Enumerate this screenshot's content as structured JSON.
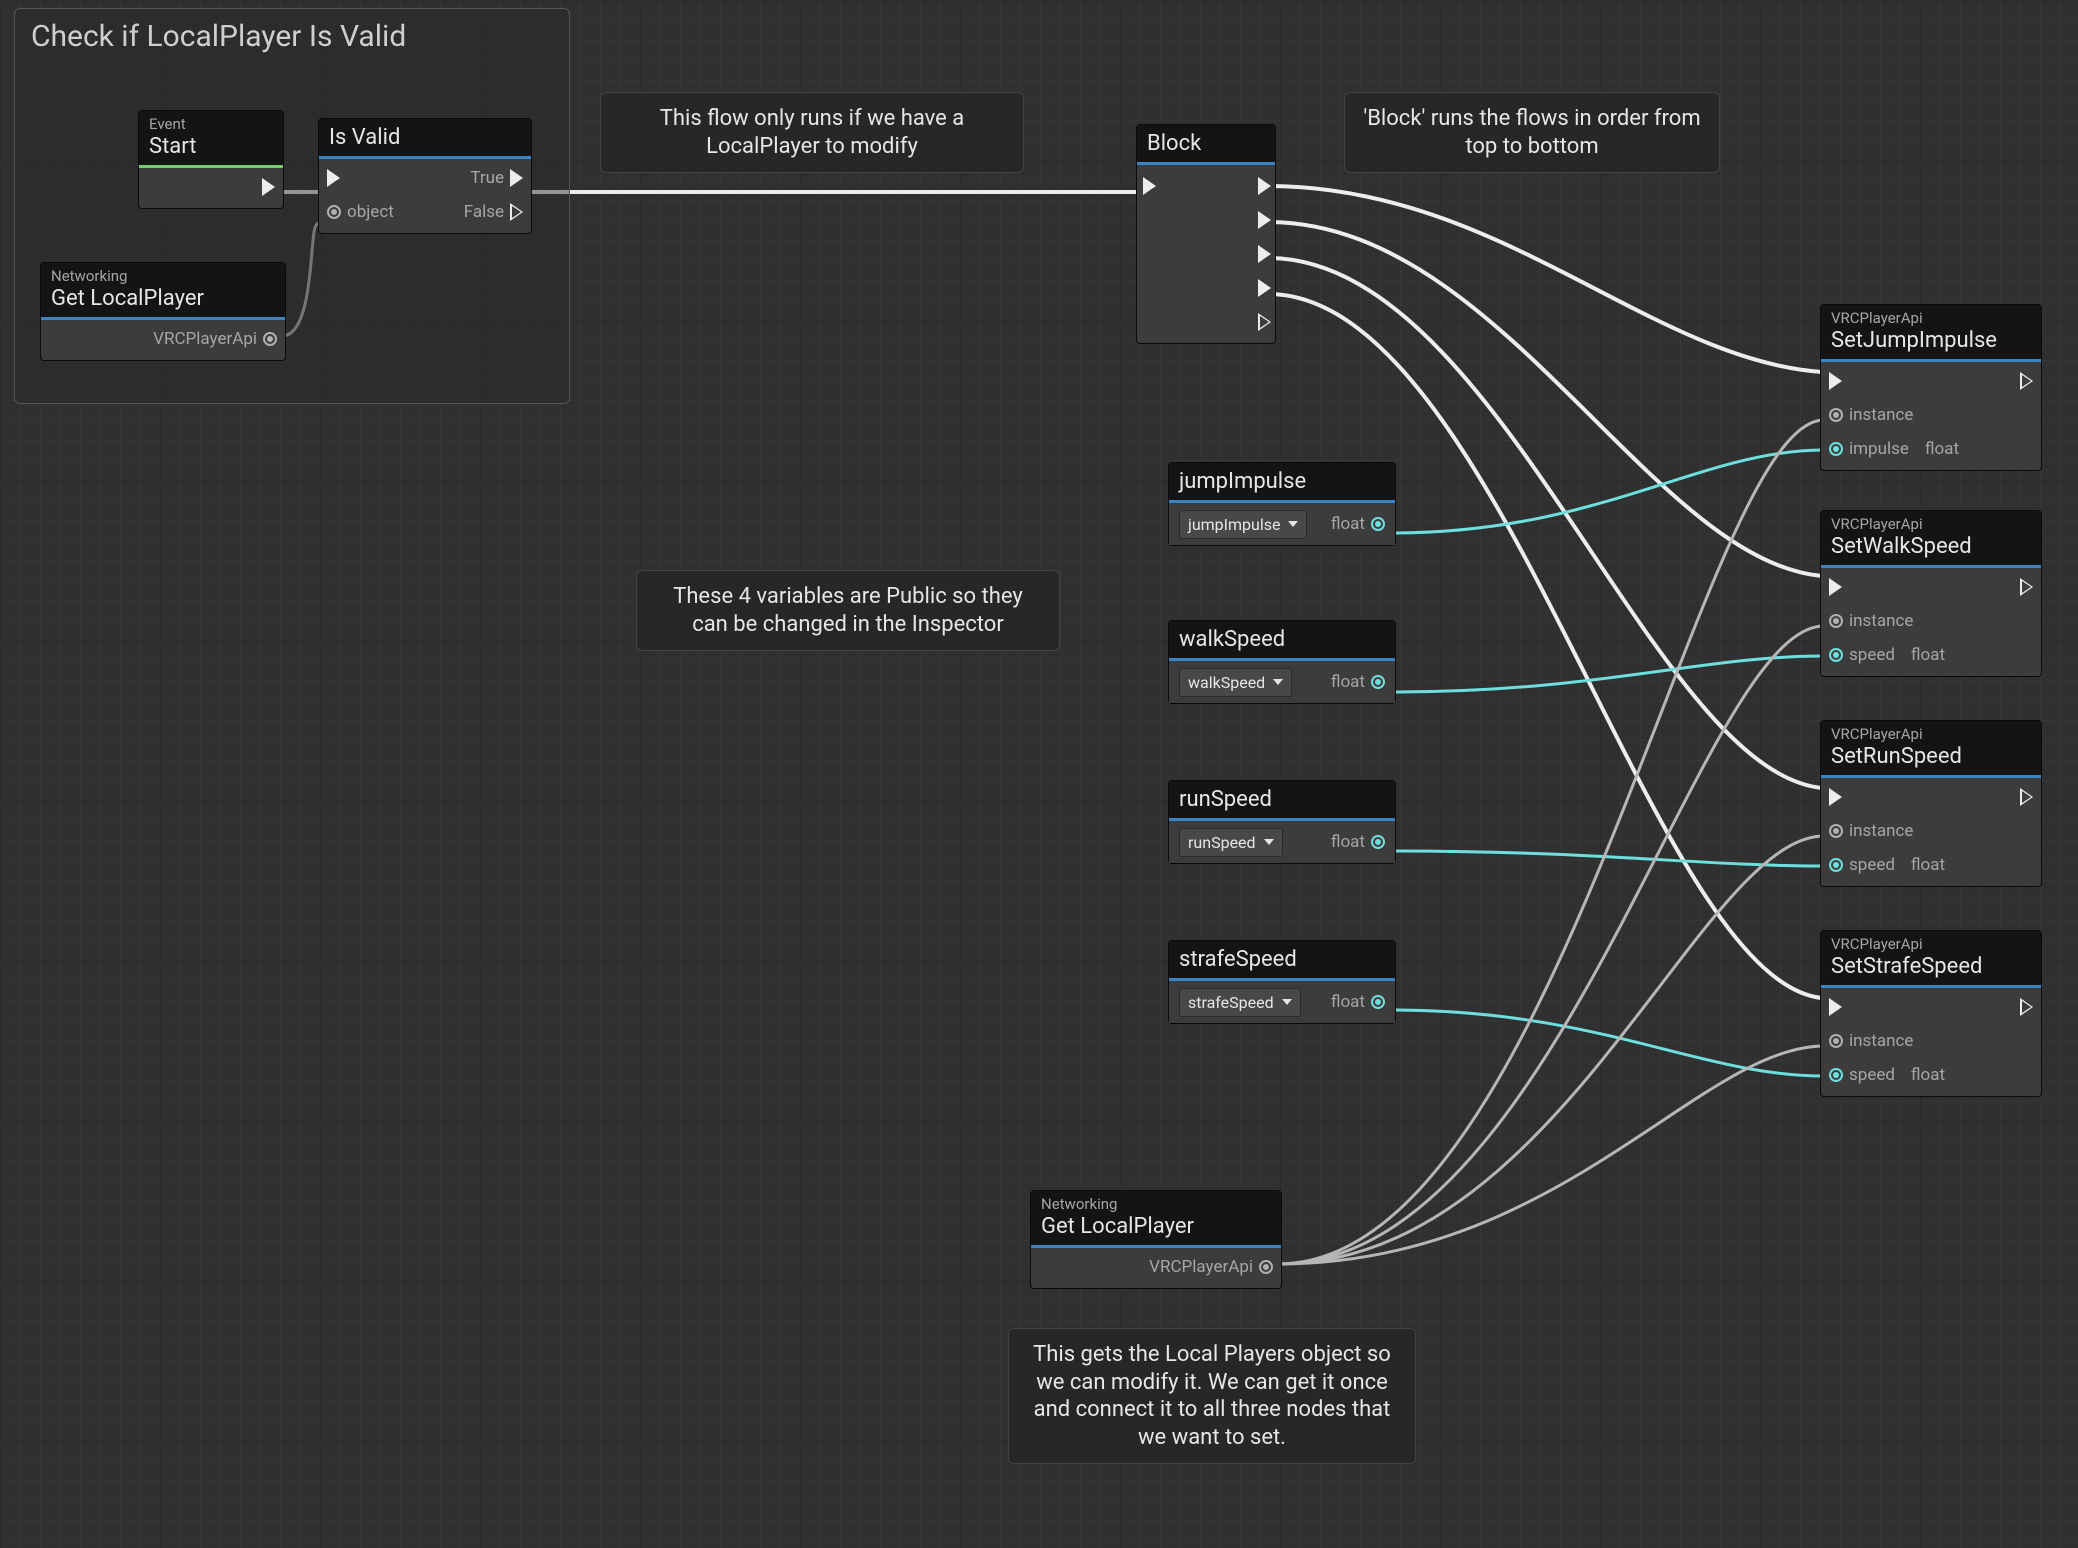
{
  "group": {
    "title": "Check if LocalPlayer Is Valid"
  },
  "comments": {
    "flow_runs": "This flow only runs if we have a LocalPlayer to modify",
    "block_order": "'Block' runs the flows in order from top to bottom",
    "public_vars": "These 4 variables are Public so they can be changed in the Inspector",
    "get_local_explain": "This gets the Local Players object so we can modify it. We can get it once and connect it to all three nodes that we want to set."
  },
  "nodes": {
    "start": {
      "supertitle": "Event",
      "title": "Start"
    },
    "is_valid": {
      "title": "Is Valid",
      "in_object": "object",
      "out_true": "True",
      "out_false": "False"
    },
    "get_local_1": {
      "supertitle": "Networking",
      "title": "Get LocalPlayer",
      "output": "VRCPlayerApi"
    },
    "block": {
      "title": "Block"
    },
    "get_local_2": {
      "supertitle": "Networking",
      "title": "Get LocalPlayer",
      "output": "VRCPlayerApi"
    },
    "set_jump": {
      "supertitle": "VRCPlayerApi",
      "title": "SetJumpImpulse",
      "p1": "instance",
      "p2": "impulse",
      "p2type": "float"
    },
    "set_walk": {
      "supertitle": "VRCPlayerApi",
      "title": "SetWalkSpeed",
      "p1": "instance",
      "p2": "speed",
      "p2type": "float"
    },
    "set_run": {
      "supertitle": "VRCPlayerApi",
      "title": "SetRunSpeed",
      "p1": "instance",
      "p2": "speed",
      "p2type": "float"
    },
    "set_strafe": {
      "supertitle": "VRCPlayerApi",
      "title": "SetStrafeSpeed",
      "p1": "instance",
      "p2": "speed",
      "p2type": "float"
    }
  },
  "variables": {
    "jumpImpulse": {
      "title": "jumpImpulse",
      "drop": "jumpImpulse",
      "type": "float"
    },
    "walkSpeed": {
      "title": "walkSpeed",
      "drop": "walkSpeed",
      "type": "float"
    },
    "runSpeed": {
      "title": "runSpeed",
      "drop": "runSpeed",
      "type": "float"
    },
    "strafeSpeed": {
      "title": "strafeSpeed",
      "drop": "strafeSpeed",
      "type": "float"
    }
  }
}
